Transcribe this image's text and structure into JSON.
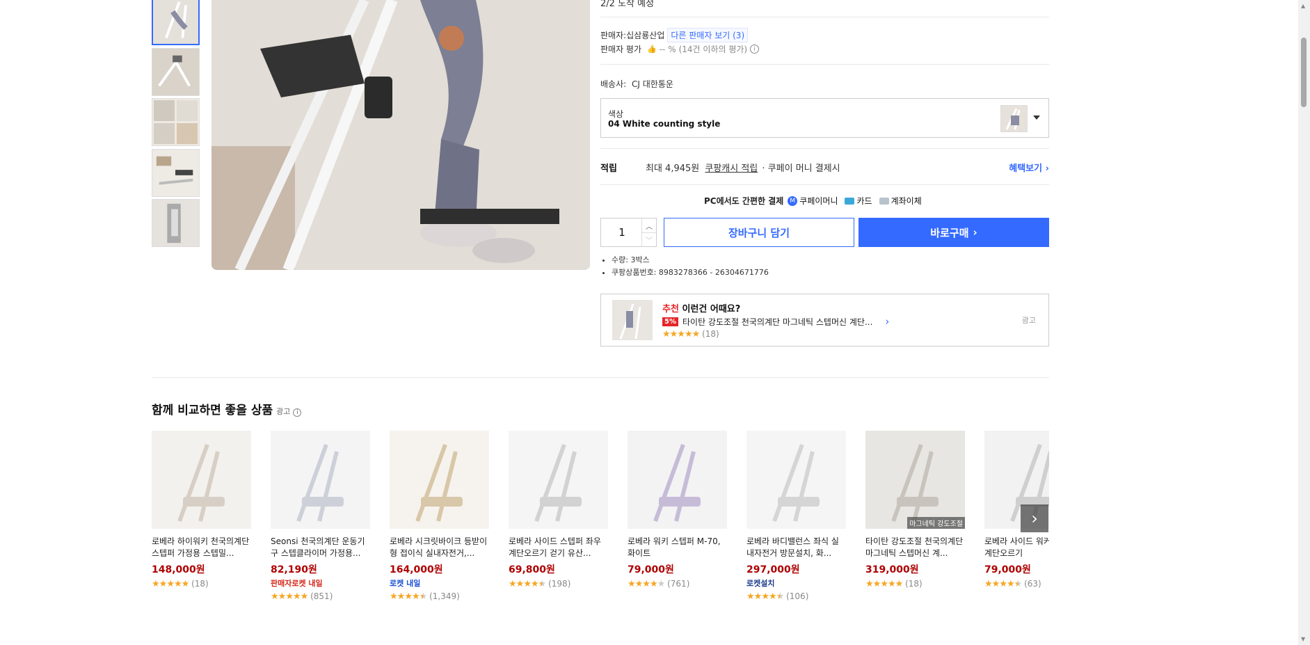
{
  "delivery": {
    "arrival": "2/2 도착 예정"
  },
  "seller": {
    "label": "판매자:",
    "name": "십삼룡산업",
    "other_sellers": "다른 판매자 보기",
    "other_count": "(3)",
    "rating_label": "판매자 평가",
    "rating_value": "-- %",
    "rating_note": "(14건 이하의 평가)"
  },
  "shipping": {
    "label": "배송사:",
    "company": "CJ 대한통운"
  },
  "option": {
    "label": "색상",
    "value": "04 White counting style"
  },
  "reward": {
    "label": "적립",
    "max": "최대 4,945원",
    "cash": "쿠팡캐시 적립",
    "rest": "· 쿠페이 머니 결제시",
    "benefit_link": "혜택보기"
  },
  "payment": {
    "title": "PC에서도 간편한 결제",
    "methods": [
      "쿠페이머니",
      "카드",
      "계좌이체"
    ]
  },
  "purchase": {
    "quantity": "1",
    "cart": "장바구니 담기",
    "buy_now": "바로구매"
  },
  "details": {
    "items": [
      "수량: 3박스",
      "쿠팡상품번호: 8983278366 - 26304671776"
    ]
  },
  "recommend": {
    "tag": "추천",
    "title": "이런건 어때요?",
    "discount": "5%",
    "product": "타이탄 강도조절 천국의계단 마그네틱 스텝머신 계단...",
    "reviews": "(18)",
    "ad": "광고"
  },
  "compare": {
    "title": "함께 비교하면 좋을 상품",
    "ad": "광고",
    "products": [
      {
        "name": "로베라 하이워키 천국의계단 스텝퍼 가정용 스텝밀...",
        "price": "148,000원",
        "badge": "",
        "reviews": "(18)",
        "rating": 5
      },
      {
        "name": "Seonsi 천국의계단 운동기구 스텝클라이머 가정용...",
        "price": "82,190원",
        "badge": "판매자로켓 내일",
        "reviews": "(851)",
        "rating": 5
      },
      {
        "name": "로베라 시크릿바이크 등받이형 접이식 실내자전거,...",
        "price": "164,000원",
        "badge": "로켓 내일",
        "reviews": "(1,349)",
        "rating": 4.5
      },
      {
        "name": "로베라 사이드 스텝퍼 좌우 계단오르기 걷기 유산...",
        "price": "69,800원",
        "badge": "",
        "reviews": "(198)",
        "rating": 4.5
      },
      {
        "name": "로베라 워키 스텝퍼 M-70, 화이트",
        "price": "79,000원",
        "badge": "",
        "reviews": "(761)",
        "rating": 4
      },
      {
        "name": "로베라 바디밸런스 좌식 실내자전거 방문설치, 화...",
        "price": "297,000원",
        "badge": "로켓설치",
        "reviews": "(106)",
        "rating": 4.5
      },
      {
        "name": "타이탄 강도조절 천국의계단 마그네틱 스텝머신 계...",
        "price": "319,000원",
        "badge": "",
        "reviews": "(18)",
        "rating": 5,
        "overlay": "마그네틱 강도조절"
      },
      {
        "name": "로베라 사이드 워커 퍼 좌우 계단오르기",
        "price": "79,000원",
        "badge": "",
        "reviews": "(63)",
        "rating": 4.5
      }
    ]
  },
  "colors": {
    "accent": "#346aff",
    "price": "#ae0000",
    "star": "#f5a623"
  }
}
